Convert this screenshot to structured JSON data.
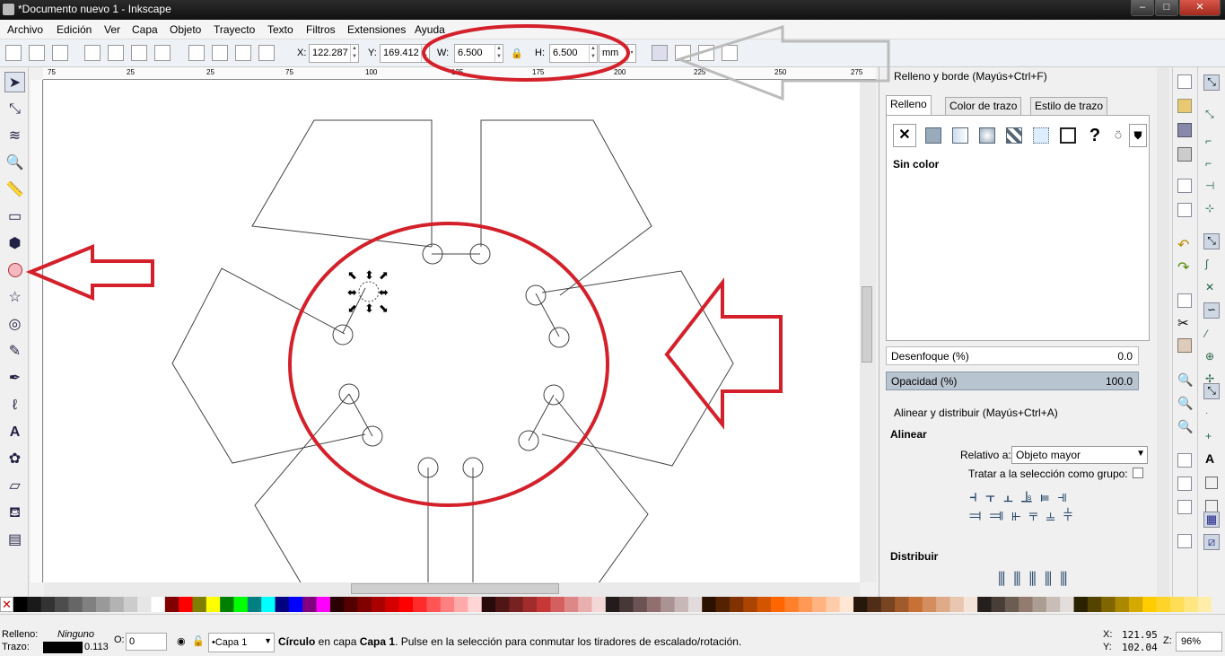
{
  "window": {
    "title": "*Documento nuevo 1 - Inkscape",
    "min": "–",
    "max": "□",
    "close": "✕"
  },
  "menu": [
    "Archivo",
    "Edición",
    "Ver",
    "Capa",
    "Objeto",
    "Trayecto",
    "Texto",
    "Filtros",
    "Extensiones",
    "Ayuda"
  ],
  "controls": {
    "x_label": "X:",
    "x_value": "122.287",
    "y_label": "Y:",
    "y_value": "169.412",
    "w_label": "W:",
    "w_value": "6.500",
    "h_label": "H:",
    "h_value": "6.500",
    "unit": "mm"
  },
  "ruler": {
    "ticks": [
      "75",
      "50",
      "25",
      "0",
      "25",
      "50",
      "75",
      "100",
      "125",
      "150",
      "175",
      "200",
      "225",
      "250",
      "275"
    ]
  },
  "fill_panel": {
    "title": "Relleno y borde (Mayús+Ctrl+F)",
    "tabs": [
      "Relleno",
      "Color de trazo",
      "Estilo de trazo"
    ],
    "paint_none": "✕",
    "paint_unknown": "?",
    "state": "Sin color",
    "blur_label": "Desenfoque (%)",
    "blur_value": "0.0",
    "opacity_label": "Opacidad (%)",
    "opacity_value": "100.0"
  },
  "align_panel": {
    "title": "Alinear y distribuir (Mayús+Ctrl+A)",
    "align_heading": "Alinear",
    "relative_label": "Relativo a:",
    "relative_value": "Objeto mayor",
    "group_label": "Tratar a la selección como grupo:",
    "distribute_heading": "Distribuir"
  },
  "status": {
    "fill_label": "Relleno:",
    "fill_value": "Ninguno",
    "stroke_label": "Trazo:",
    "stroke_width": "0.113",
    "opacity_label": "O:",
    "opacity_value": "0",
    "layer": "•Capa 1",
    "message_obj": "Círculo",
    "message_mid": " en capa ",
    "message_layer": "Capa 1",
    "message_end": ". Pulse en la selección para conmutar los tiradores de escalado/rotación.",
    "cx_label": "X:",
    "cx": "121.95",
    "cy_label": "Y:",
    "cy": "102.04",
    "zoom_label": "Z:",
    "zoom": "96%"
  },
  "palette": [
    "#000000",
    "#1a1a1a",
    "#333333",
    "#4d4d4d",
    "#666666",
    "#808080",
    "#999999",
    "#b3b3b3",
    "#cccccc",
    "#e6e6e6",
    "#ffffff",
    "#800000",
    "#ff0000",
    "#808000",
    "#ffff00",
    "#008000",
    "#00ff00",
    "#008080",
    "#00ffff",
    "#000080",
    "#0000ff",
    "#800080",
    "#ff00ff",
    "#2b0000",
    "#550000",
    "#800000",
    "#aa0000",
    "#d40000",
    "#ff0000",
    "#ff2a2a",
    "#ff5555",
    "#ff8080",
    "#ffaaaa",
    "#ffd5d5",
    "#280b0b",
    "#501616",
    "#782121",
    "#a02c2c",
    "#c83737",
    "#d35f5f",
    "#de8787",
    "#e9afaf",
    "#f4d7d7",
    "#241c1c",
    "#483737",
    "#6c5353",
    "#916f6f",
    "#ac9393",
    "#c8b7b7",
    "#e3dbdb",
    "#2b1100",
    "#552200",
    "#803300",
    "#aa4400",
    "#d45500",
    "#ff6600",
    "#ff7f2a",
    "#ff9955",
    "#ffb380",
    "#ffccaa",
    "#ffe6d5",
    "#28170b",
    "#502d16",
    "#784421",
    "#a05a2c",
    "#c87137",
    "#d38d5f",
    "#deaa87",
    "#e9c6af",
    "#f4e3d7",
    "#241f1c",
    "#483e37",
    "#6c5d53",
    "#917c6f",
    "#ac9d93",
    "#c8beb7",
    "#e3dedb",
    "#2b2200",
    "#554400",
    "#806600",
    "#aa8800",
    "#d4aa00",
    "#ffcc00",
    "#ffd42a",
    "#ffdd55",
    "#ffe680",
    "#ffeeaa"
  ]
}
